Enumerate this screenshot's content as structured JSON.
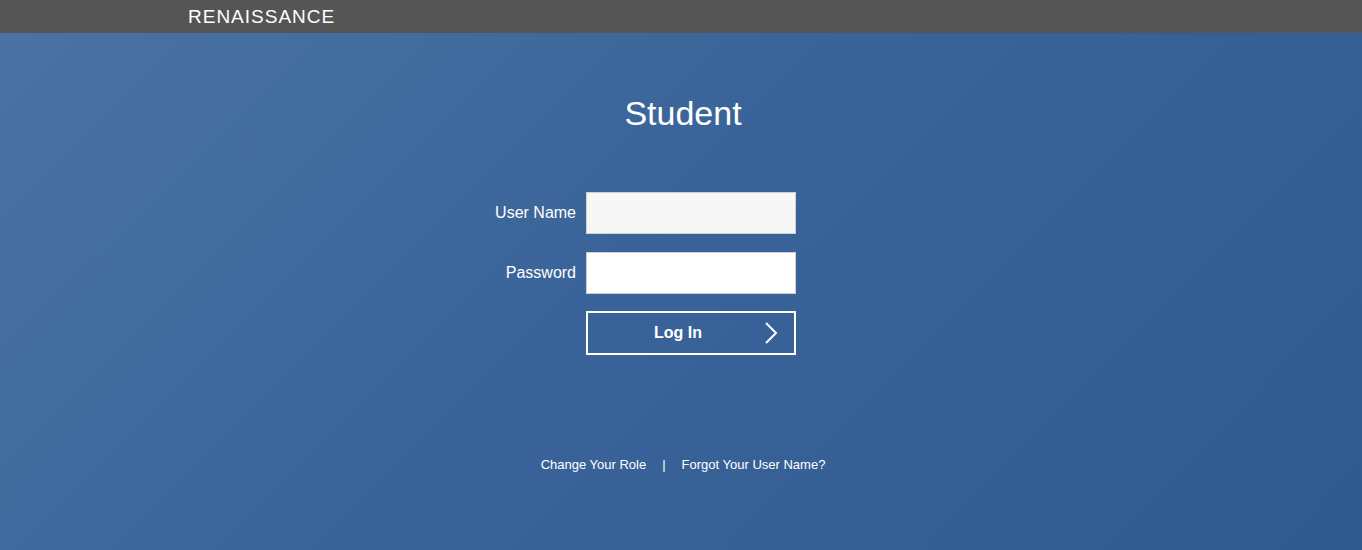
{
  "header": {
    "brand": "RENAISSANCE"
  },
  "page": {
    "title": "Student"
  },
  "fields": [
    {
      "label": "User Name",
      "value": "",
      "type": "text",
      "focused": true
    },
    {
      "label": "Password",
      "value": "",
      "type": "password",
      "focused": false
    }
  ],
  "login_button": {
    "label": "Log In"
  },
  "links": [
    {
      "label": "Change Your Role"
    },
    {
      "label": "Forgot Your User Name?"
    }
  ],
  "link_separator": "|"
}
